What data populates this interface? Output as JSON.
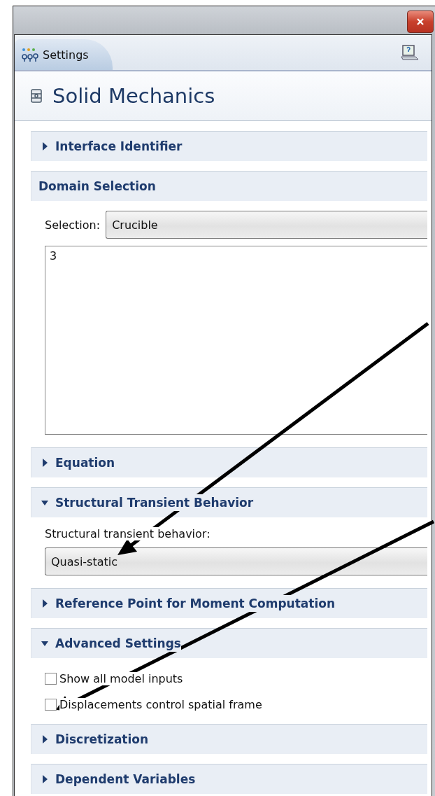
{
  "tab": {
    "label": "Settings",
    "selected": true
  },
  "header": {
    "title": "Solid Mechanics"
  },
  "sections": [
    {
      "kind": "collapsible",
      "title": "Interface Identifier",
      "expanded": false
    },
    {
      "kind": "plain",
      "title": "Domain Selection",
      "fields": [
        {
          "kind": "combo",
          "label": "Selection:",
          "value": "Crucible"
        },
        {
          "kind": "list",
          "items": [
            "3"
          ]
        }
      ]
    },
    {
      "kind": "collapsible",
      "title": "Equation",
      "expanded": false
    },
    {
      "kind": "collapsible",
      "title": "Structural Transient Behavior",
      "expanded": true,
      "fields": [
        {
          "kind": "label",
          "text": "Structural transient behavior:"
        },
        {
          "kind": "combo",
          "value": "Quasi-static"
        }
      ]
    },
    {
      "kind": "collapsible",
      "title": "Reference Point for Moment Computation",
      "expanded": false
    },
    {
      "kind": "collapsible",
      "title": "Advanced Settings",
      "expanded": true,
      "fields": [
        {
          "kind": "checkbox",
          "label": "Show all model inputs",
          "checked": false
        },
        {
          "kind": "checkbox",
          "label": "Displacements control spatial frame",
          "checked": false
        }
      ]
    },
    {
      "kind": "collapsible",
      "title": "Discretization",
      "expanded": false
    },
    {
      "kind": "collapsible",
      "title": "Dependent Variables",
      "expanded": false
    }
  ]
}
